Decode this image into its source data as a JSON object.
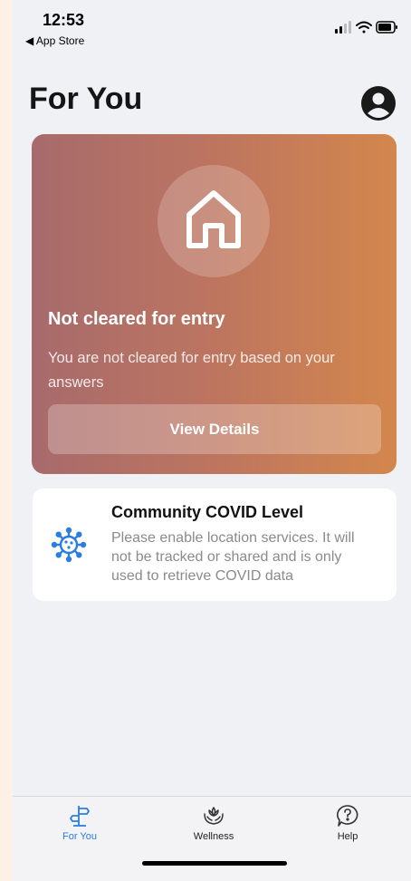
{
  "status_bar": {
    "time": "12:53",
    "back_label": "◀ App Store"
  },
  "header": {
    "title": "For You",
    "avatar_icon": "person-circle-icon"
  },
  "entry_card": {
    "icon": "house-icon",
    "title": "Not cleared for entry",
    "description": "You are not cleared for entry based on your answers",
    "button_label": "View Details",
    "gradient_colors": [
      "#a76a6c",
      "#d3874c"
    ]
  },
  "covid_card": {
    "icon": "virus-icon",
    "title": "Community COVID Level",
    "description": "Please enable location services. It will not be tracked or shared and is only used to retrieve COVID data"
  },
  "tab_bar": {
    "tabs": [
      {
        "label": "For You",
        "icon": "signpost-icon",
        "active": true
      },
      {
        "label": "Wellness",
        "icon": "lotus-hands-icon",
        "active": false
      },
      {
        "label": "Help",
        "icon": "question-bubble-icon",
        "active": false
      }
    ]
  },
  "colors": {
    "accent": "#2a7de1",
    "background": "#f0f1f5"
  }
}
